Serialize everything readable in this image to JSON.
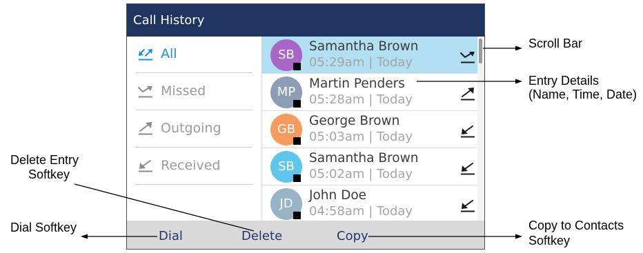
{
  "screen": {
    "title": "Call History",
    "filters": [
      {
        "label": "All",
        "icon": "all-calls-icon",
        "selected": true
      },
      {
        "label": "Missed",
        "icon": "missed-call-icon",
        "selected": false
      },
      {
        "label": "Outgoing",
        "icon": "outgoing-call-icon",
        "selected": false
      },
      {
        "label": "Received",
        "icon": "received-call-icon",
        "selected": false
      }
    ],
    "entries": [
      {
        "initials": "SB",
        "name": "Samantha Brown",
        "time": "05:29am",
        "date": "Today",
        "type_icon": "missed-call-icon",
        "avatar_color": "#a766c8",
        "selected": true
      },
      {
        "initials": "MP",
        "name": "Martin Penders",
        "time": "05:28am",
        "date": "Today",
        "type_icon": "outgoing-call-icon",
        "avatar_color": "#8d9db5",
        "selected": false
      },
      {
        "initials": "GB",
        "name": "George Brown",
        "time": "05:03am",
        "date": "Today",
        "type_icon": "received-call-icon",
        "avatar_color": "#f69b5d",
        "selected": false
      },
      {
        "initials": "SB",
        "name": "Samantha Brown",
        "time": "05:02am",
        "date": "Today",
        "type_icon": "received-call-icon",
        "avatar_color": "#5ec5ec",
        "selected": false
      },
      {
        "initials": "JD",
        "name": "John Doe",
        "time": "04:58am",
        "date": "Today",
        "type_icon": "received-call-icon",
        "avatar_color": "#98b2c6",
        "selected": false
      }
    ],
    "time_date_separator": "|",
    "softkeys": {
      "dial": "Dial",
      "delete": "Delete",
      "copy": "Copy"
    }
  },
  "callouts": {
    "scroll_bar": "Scroll Bar",
    "entry_details": "Entry Details",
    "entry_details_note": "(Name, Time, Date)",
    "delete_entry": "Delete Entry",
    "delete_entry_suffix": "Softkey",
    "dial_softkey": "Dial Softkey",
    "copy_to_contacts": "Copy to Contacts",
    "copy_to_contacts_suffix": "Softkey"
  },
  "colors": {
    "header_bg": "#1f3460",
    "accent": "#1e8fd6",
    "selected_row_bg": "#b3dff2",
    "softkey_bar_bg": "#d9d9d9",
    "softkey_text": "#22386a"
  }
}
